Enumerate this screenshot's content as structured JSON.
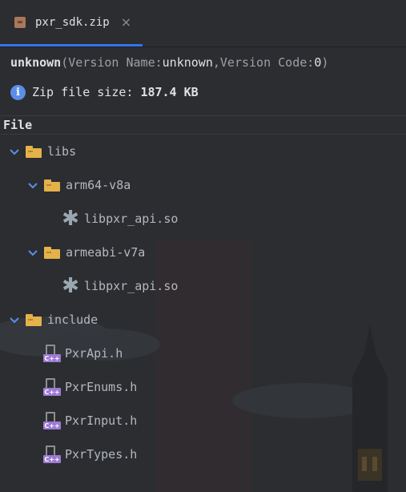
{
  "tab": {
    "label": "pxr_sdk.zip",
    "close": "×"
  },
  "summary": {
    "name": "unknown",
    "paren_open": " (",
    "version_name_label": "Version Name: ",
    "version_name": "unknown",
    "sep": ", ",
    "version_code_label": "Version Code: ",
    "version_code": "0",
    "paren_close": ")"
  },
  "zip": {
    "label": "Zip file size:",
    "size": "187.4 KB"
  },
  "header": {
    "column": "File"
  },
  "tree": {
    "libs": "libs",
    "arm64": "arm64-v8a",
    "arm64_file": "libpxr_api.so",
    "armeabi": "armeabi-v7a",
    "armeabi_file": "libpxr_api.so",
    "include": "include",
    "h1": "PxrApi.h",
    "h2": "PxrEnums.h",
    "h3": "PxrInput.h",
    "h4": "PxrTypes.h",
    "cpp_tag": "C++"
  },
  "colors": {
    "background": "#2b2d30",
    "folder": "#e4b24a",
    "chevron": "#5b8ee8",
    "cpp_badge": "#9d7ad4",
    "tab_underline": "#3574f0"
  }
}
